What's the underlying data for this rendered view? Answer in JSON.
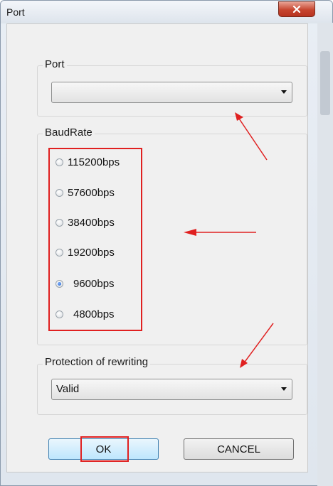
{
  "window": {
    "title": "Port"
  },
  "port_group": {
    "label": "Port",
    "value": ""
  },
  "baud_group": {
    "label": "BaudRate",
    "options": [
      {
        "label": "115200bps",
        "checked": false
      },
      {
        "label": "57600bps",
        "checked": false
      },
      {
        "label": "38400bps",
        "checked": false
      },
      {
        "label": "19200bps",
        "checked": false
      },
      {
        "label": "9600bps",
        "checked": true
      },
      {
        "label": "4800bps",
        "checked": false
      }
    ]
  },
  "protection_group": {
    "label": "Protection of rewriting",
    "value": "Valid"
  },
  "buttons": {
    "ok": "OK",
    "cancel": "CANCEL"
  },
  "colors": {
    "annotation": "#e02020",
    "ok_border": "#3c7fb1",
    "close": "#c6452f"
  },
  "icons": [
    "close-icon",
    "dropdown-arrow-icon",
    "radio-icon",
    "annotation-arrow-icon"
  ]
}
